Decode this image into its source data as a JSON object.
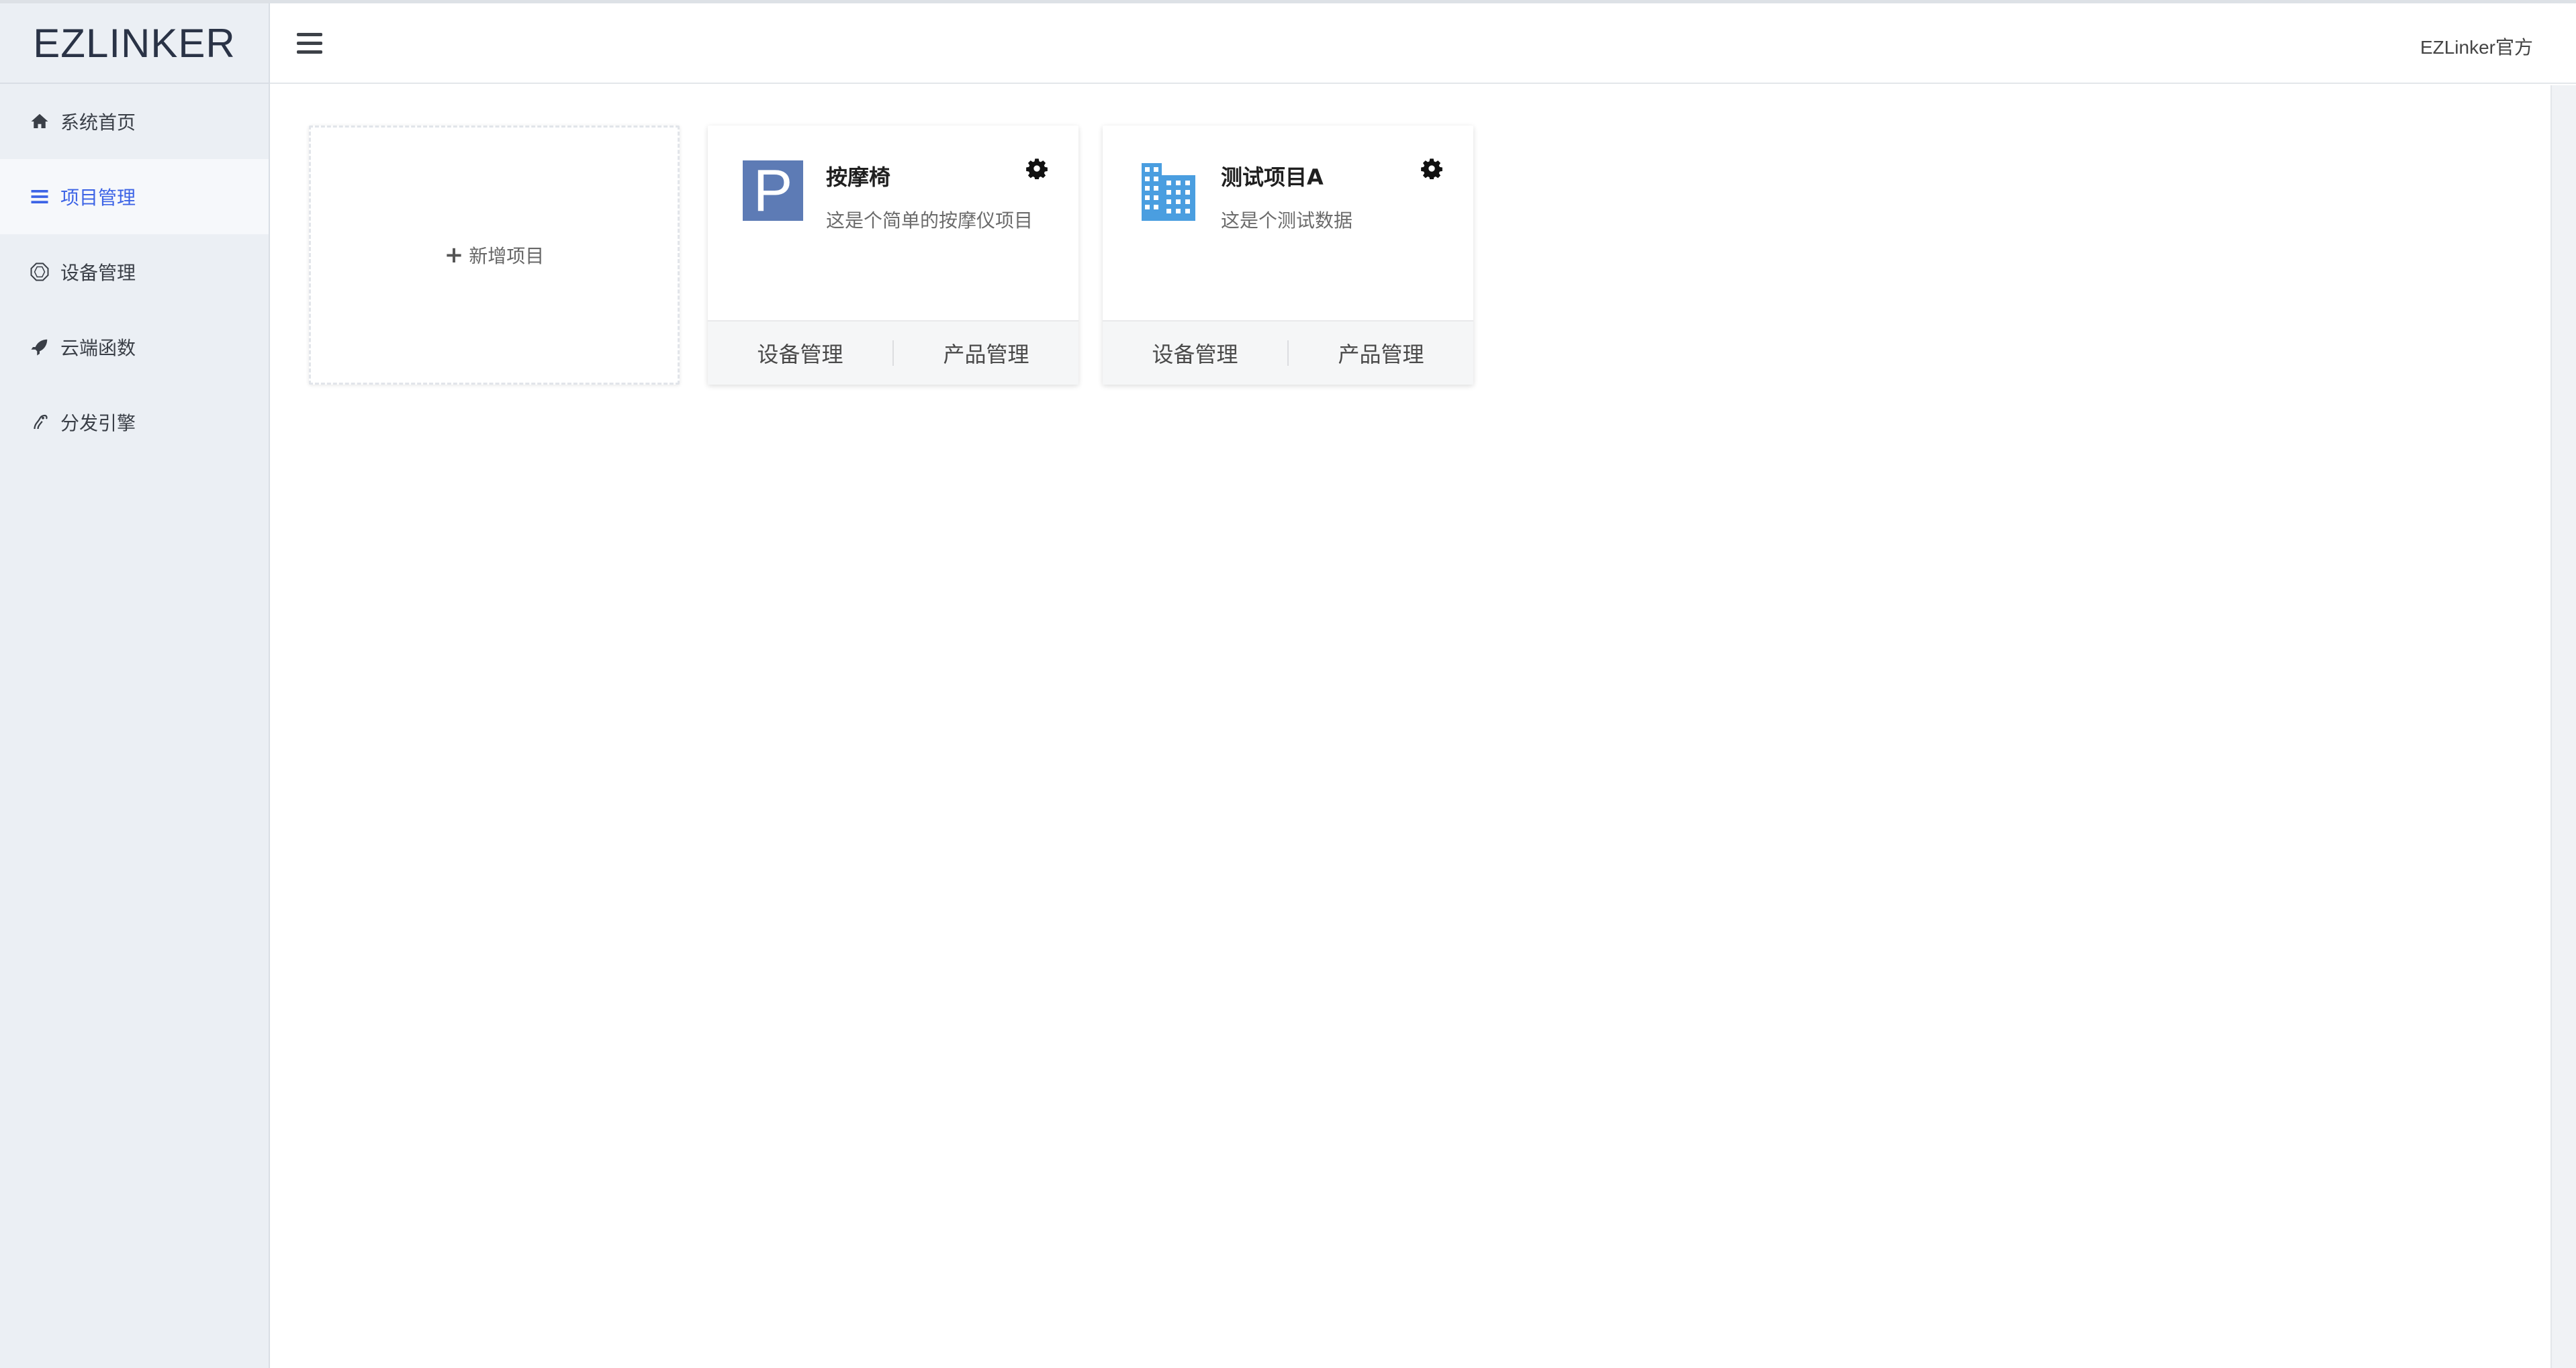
{
  "sidebar": {
    "logo": "EZLINKER",
    "items": [
      {
        "label": "系统首页",
        "icon": "home-icon"
      },
      {
        "label": "项目管理",
        "icon": "list-icon",
        "active": true
      },
      {
        "label": "设备管理",
        "icon": "device-icon"
      },
      {
        "label": "云端函数",
        "icon": "rocket-icon"
      },
      {
        "label": "分发引擎",
        "icon": "engine-icon"
      }
    ]
  },
  "header": {
    "user": "EZLinker官方"
  },
  "main": {
    "add_project_label": "新增项目",
    "projects": [
      {
        "title": "按摩椅",
        "desc": "这是个简单的按摩仪项目",
        "logo_letter": "P",
        "actions": [
          "设备管理",
          "产品管理"
        ]
      },
      {
        "title": "测试项目A",
        "desc": "这是个测试数据",
        "logo_icon": "building-icon",
        "actions": [
          "设备管理",
          "产品管理"
        ]
      }
    ]
  },
  "colors": {
    "accent": "#3d64e6",
    "sidebar_bg": "#ebeff4",
    "logo_p_bg": "#5d7bb5",
    "building_blue": "#4a9ee0"
  }
}
